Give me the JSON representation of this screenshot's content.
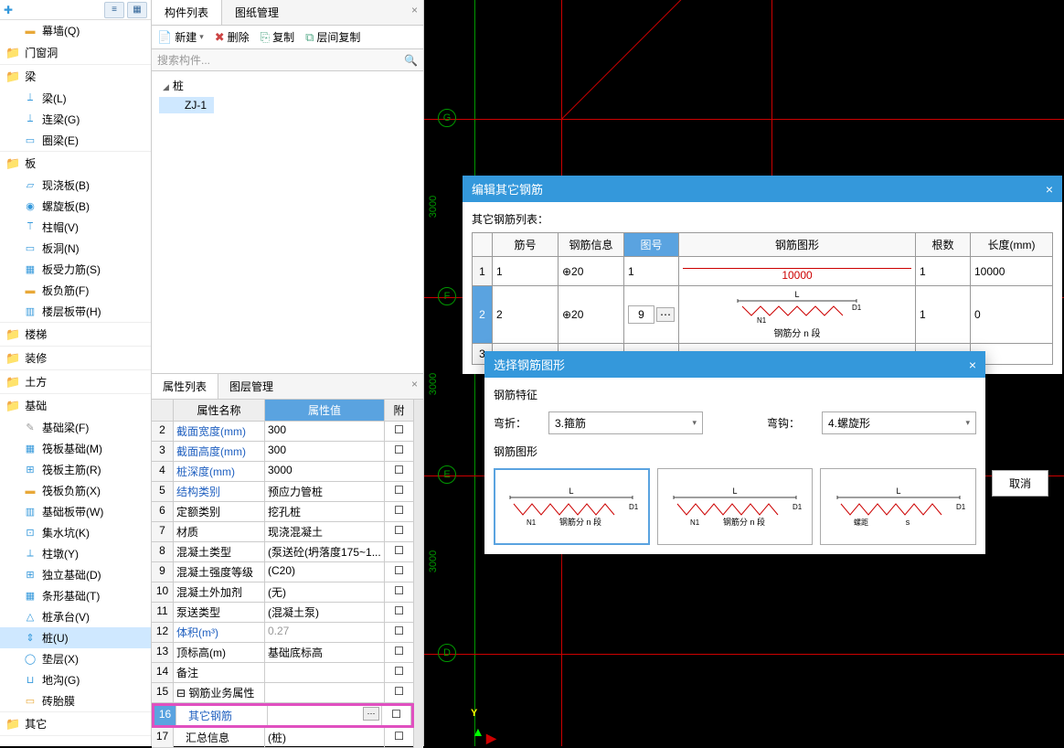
{
  "nav": {
    "top_icons": [
      "≡",
      "▦"
    ],
    "groups": [
      {
        "kind": "item-indent",
        "icon": "▬",
        "color": "#e8a838",
        "label": "幕墙(Q)"
      },
      {
        "kind": "group",
        "label": "门窗洞"
      },
      {
        "kind": "group",
        "label": "梁",
        "children": [
          {
            "icon": "⟘",
            "color": "#3498db",
            "label": "梁(L)"
          },
          {
            "icon": "⟘",
            "color": "#3498db",
            "label": "连梁(G)"
          },
          {
            "icon": "▭",
            "color": "#3498db",
            "label": "圈梁(E)"
          }
        ]
      },
      {
        "kind": "group",
        "label": "板",
        "children": [
          {
            "icon": "▱",
            "color": "#3498db",
            "label": "现浇板(B)"
          },
          {
            "icon": "◉",
            "color": "#3498db",
            "label": "螺旋板(B)"
          },
          {
            "icon": "⟙",
            "color": "#3498db",
            "label": "柱帽(V)"
          },
          {
            "icon": "▭",
            "color": "#3498db",
            "label": "板洞(N)"
          },
          {
            "icon": "▦",
            "color": "#3498db",
            "label": "板受力筋(S)"
          },
          {
            "icon": "▬",
            "color": "#e8a838",
            "label": "板负筋(F)"
          },
          {
            "icon": "▥",
            "color": "#3498db",
            "label": "楼层板带(H)"
          }
        ]
      },
      {
        "kind": "group",
        "label": "楼梯"
      },
      {
        "kind": "group",
        "label": "装修"
      },
      {
        "kind": "group",
        "label": "土方"
      },
      {
        "kind": "group",
        "label": "基础",
        "children": [
          {
            "icon": "✎",
            "color": "#999",
            "label": "基础梁(F)"
          },
          {
            "icon": "▦",
            "color": "#3498db",
            "label": "筏板基础(M)"
          },
          {
            "icon": "⊞",
            "color": "#3498db",
            "label": "筏板主筋(R)"
          },
          {
            "icon": "▬",
            "color": "#e8a838",
            "label": "筏板负筋(X)"
          },
          {
            "icon": "▥",
            "color": "#3498db",
            "label": "基础板带(W)"
          },
          {
            "icon": "⊡",
            "color": "#3498db",
            "label": "集水坑(K)"
          },
          {
            "icon": "⟂",
            "color": "#3498db",
            "label": "柱墩(Y)"
          },
          {
            "icon": "⊞",
            "color": "#3498db",
            "label": "独立基础(D)"
          },
          {
            "icon": "▦",
            "color": "#3498db",
            "label": "条形基础(T)"
          },
          {
            "icon": "△",
            "color": "#3498db",
            "label": "桩承台(V)"
          },
          {
            "icon": "⇕",
            "color": "#3498db",
            "label": "桩(U)",
            "selected": true
          },
          {
            "icon": "◯",
            "color": "#3498db",
            "label": "垫层(X)"
          },
          {
            "icon": "⊔",
            "color": "#3498db",
            "label": "地沟(G)"
          },
          {
            "icon": "▭",
            "color": "#e8a838",
            "label": "砖胎膜"
          }
        ]
      },
      {
        "kind": "group",
        "label": "其它"
      }
    ]
  },
  "mid": {
    "tabs": [
      "构件列表",
      "图纸管理"
    ],
    "toolbar": {
      "new": "新建",
      "delete": "删除",
      "copy": "复制",
      "layer_copy": "层间复制"
    },
    "search_placeholder": "搜索构件...",
    "tree": {
      "root": "桩",
      "child": "ZJ-1"
    }
  },
  "prop": {
    "tabs": [
      "属性列表",
      "图层管理"
    ],
    "headers": {
      "name": "属性名称",
      "value": "属性值",
      "att": "附"
    },
    "rows": [
      {
        "n": "2",
        "name": "截面宽度(mm)",
        "link": true,
        "val": "300"
      },
      {
        "n": "3",
        "name": "截面高度(mm)",
        "link": true,
        "val": "300"
      },
      {
        "n": "4",
        "name": "桩深度(mm)",
        "link": true,
        "val": "3000"
      },
      {
        "n": "5",
        "name": "结构类别",
        "link": true,
        "val": "预应力管桩"
      },
      {
        "n": "6",
        "name": "定额类别",
        "val": "挖孔桩"
      },
      {
        "n": "7",
        "name": "材质",
        "val": "现浇混凝土"
      },
      {
        "n": "8",
        "name": "混凝土类型",
        "val": "(泵送砼(坍落度175~1..."
      },
      {
        "n": "9",
        "name": "混凝土强度等级",
        "val": "(C20)"
      },
      {
        "n": "10",
        "name": "混凝土外加剂",
        "val": "(无)"
      },
      {
        "n": "11",
        "name": "泵送类型",
        "val": "(混凝土泵)"
      },
      {
        "n": "12",
        "name": "体积(m³)",
        "link": true,
        "val": "0.27",
        "gray": true
      },
      {
        "n": "13",
        "name": "顶标高(m)",
        "val": "基础底标高"
      },
      {
        "n": "14",
        "name": "备注",
        "val": ""
      },
      {
        "n": "15",
        "name": "钢筋业务属性",
        "val": "",
        "expand": true
      },
      {
        "n": "16",
        "name": "其它钢筋",
        "link": true,
        "val": "",
        "highlight": true,
        "btn": true
      },
      {
        "n": "17",
        "name": "汇总信息",
        "val": "(桩)",
        "indent": true
      }
    ]
  },
  "canvas": {
    "axis_labels": [
      "G",
      "F",
      "E",
      "D"
    ],
    "dims": [
      "3000",
      "3000",
      "3000"
    ],
    "coord_y": "Y"
  },
  "rebar_dialog": {
    "title": "编辑其它钢筋",
    "list_label": "其它钢筋列表：",
    "headers": {
      "id": "筋号",
      "info": "钢筋信息",
      "fig": "图号",
      "shape": "钢筋图形",
      "count": "根数",
      "len": "长度(mm)"
    },
    "rows": [
      {
        "n": "1",
        "id": "1",
        "info": "⊕20",
        "fig": "1",
        "shape_val": "10000",
        "count": "1",
        "len": "10000"
      },
      {
        "n": "2",
        "id": "2",
        "info": "⊕20",
        "fig": "9",
        "shape_label": "钢筋分 n 段",
        "count": "1",
        "len": "0"
      },
      {
        "n": "3"
      }
    ]
  },
  "shape_dialog": {
    "title": "选择钢筋图形",
    "features_label": "钢筋特征",
    "bend_label": "弯折：",
    "bend_val": "3.箍筋",
    "hook_label": "弯钩：",
    "hook_val": "4.螺旋形",
    "gallery_label": "钢筋图形",
    "cancel": "取消",
    "shapes": [
      {
        "txt1": "N1",
        "txt2": "钢筋分 n 段",
        "dim": "D1",
        "top": "L"
      },
      {
        "txt1": "N1",
        "txt2": "钢筋分 n 段",
        "dim": "D1",
        "top": "L"
      },
      {
        "txt1": "螺距",
        "txt2": "s",
        "dim": "D1",
        "top": "L"
      }
    ]
  }
}
